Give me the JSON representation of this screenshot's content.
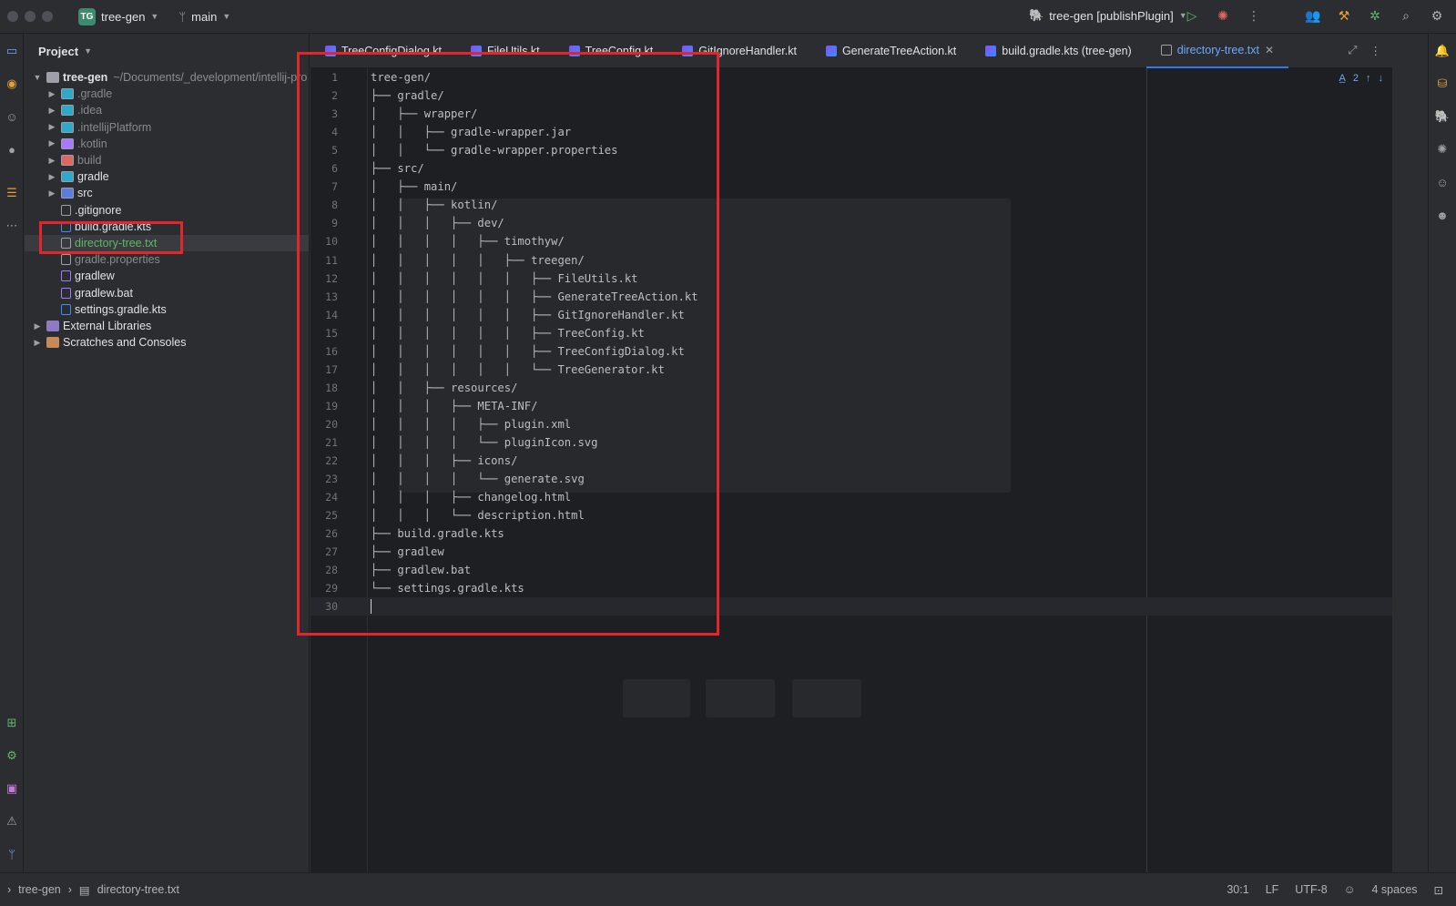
{
  "titlebar": {
    "project_badge": "TG",
    "project_name": "tree-gen",
    "branch": "main",
    "run_config": "tree-gen [publishPlugin]"
  },
  "project_panel": {
    "title": "Project",
    "tree": [
      {
        "label": "tree-gen",
        "suffix": "~/Documents/_development/intellij-pro",
        "kind": "root",
        "depth": 0,
        "expanded": true
      },
      {
        "label": ".gradle",
        "kind": "folder",
        "depth": 1,
        "color": "#2fa9c9",
        "dim": true
      },
      {
        "label": ".idea",
        "kind": "folder",
        "depth": 1,
        "color": "#2fa9c9",
        "dim": true
      },
      {
        "label": ".intellijPlatform",
        "kind": "folder",
        "depth": 1,
        "color": "#2fa9c9",
        "dim": true
      },
      {
        "label": ".kotlin",
        "kind": "folder",
        "depth": 1,
        "color": "#a57aff",
        "dim": true
      },
      {
        "label": "build",
        "kind": "folder",
        "depth": 1,
        "color": "#e0675f",
        "dim": true
      },
      {
        "label": "gradle",
        "kind": "folder",
        "depth": 1,
        "color": "#2fa9c9",
        "dim": false
      },
      {
        "label": "src",
        "kind": "folder",
        "depth": 1,
        "color": "#5c7de0",
        "dim": false
      },
      {
        "label": ".gitignore",
        "kind": "file",
        "depth": 1,
        "color": "#9da0a8",
        "dim": false
      },
      {
        "label": "build.gradle.kts",
        "kind": "file",
        "depth": 1,
        "color": "#3d8bff",
        "dim": false
      },
      {
        "label": "directory-tree.txt",
        "kind": "file",
        "depth": 1,
        "color": "#9da0a8",
        "dim": false,
        "selected": true
      },
      {
        "label": "gradle.properties",
        "kind": "file",
        "depth": 1,
        "color": "#9da0a8",
        "dim": true
      },
      {
        "label": "gradlew",
        "kind": "file",
        "depth": 1,
        "color": "#a57aff",
        "dim": false
      },
      {
        "label": "gradlew.bat",
        "kind": "file",
        "depth": 1,
        "color": "#a57aff",
        "dim": false
      },
      {
        "label": "settings.gradle.kts",
        "kind": "file",
        "depth": 1,
        "color": "#3d8bff",
        "dim": false
      },
      {
        "label": "External Libraries",
        "kind": "lib",
        "depth": 0,
        "color": "#9da0a8",
        "dim": false
      },
      {
        "label": "Scratches and Consoles",
        "kind": "scratch",
        "depth": 0,
        "color": "#c98a5a",
        "dim": false
      }
    ]
  },
  "editor_tabs": [
    {
      "label": "TreeConfigDialog.kt",
      "active": false
    },
    {
      "label": "FileUtils.kt",
      "active": false
    },
    {
      "label": "TreeConfig.kt",
      "active": false
    },
    {
      "label": "GitIgnoreHandler.kt",
      "active": false
    },
    {
      "label": "GenerateTreeAction.kt",
      "active": false
    },
    {
      "label": "build.gradle.kts (tree-gen)",
      "active": false
    },
    {
      "label": "directory-tree.txt",
      "active": true
    }
  ],
  "editor": {
    "inspection_count": "2",
    "lines": [
      "tree-gen/",
      "├── gradle/",
      "│   ├── wrapper/",
      "│   │   ├── gradle-wrapper.jar",
      "│   │   └── gradle-wrapper.properties",
      "├── src/",
      "│   ├── main/",
      "│   │   ├── kotlin/",
      "│   │   │   ├── dev/",
      "│   │   │   │   ├── timothyw/",
      "│   │   │   │   │   ├── treegen/",
      "│   │   │   │   │   │   ├── FileUtils.kt",
      "│   │   │   │   │   │   ├── GenerateTreeAction.kt",
      "│   │   │   │   │   │   ├── GitIgnoreHandler.kt",
      "│   │   │   │   │   │   ├── TreeConfig.kt",
      "│   │   │   │   │   │   ├── TreeConfigDialog.kt",
      "│   │   │   │   │   │   └── TreeGenerator.kt",
      "│   │   ├── resources/",
      "│   │   │   ├── META-INF/",
      "│   │   │   │   ├── plugin.xml",
      "│   │   │   │   └── pluginIcon.svg",
      "│   │   │   ├── icons/",
      "│   │   │   │   └── generate.svg",
      "│   │   │   ├── changelog.html",
      "│   │   │   └── description.html",
      "├── build.gradle.kts",
      "├── gradlew",
      "├── gradlew.bat",
      "└── settings.gradle.kts",
      ""
    ]
  },
  "statusbar": {
    "crumb_project": "tree-gen",
    "crumb_file": "directory-tree.txt",
    "position": "30:1",
    "line_sep": "LF",
    "encoding": "UTF-8",
    "indent": "4 spaces"
  },
  "colors": {
    "accent": "#3574f0",
    "highlight_box": "#e5252a",
    "editor_bg": "#1e1f22",
    "panel_bg": "#2b2d30"
  }
}
